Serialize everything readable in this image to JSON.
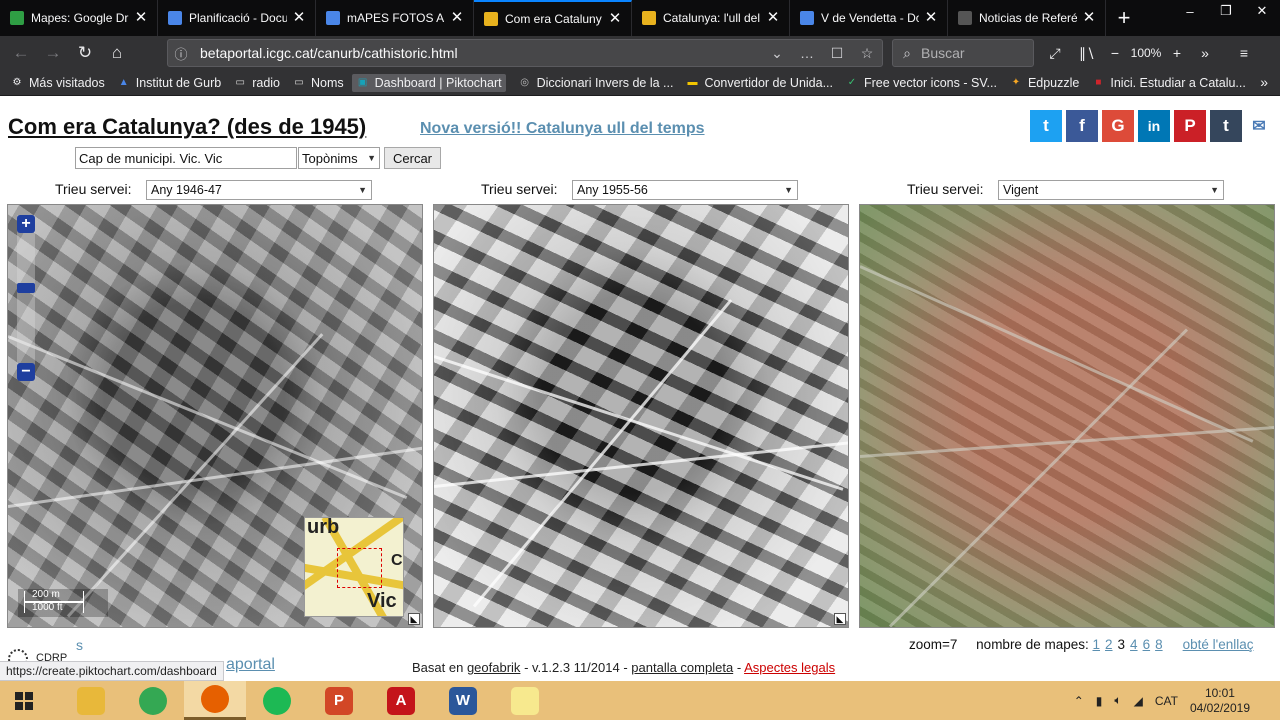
{
  "browser": {
    "tabs": [
      {
        "title": "Mapes: Google Dri",
        "icon_color": "#2f9e44",
        "active": false
      },
      {
        "title": "Planificació - Docu",
        "icon_color": "#4a86e8",
        "active": false
      },
      {
        "title": "mAPES FOTOS AN",
        "icon_color": "#4a86e8",
        "active": false
      },
      {
        "title": "Com era Cataluny",
        "icon_color": "#e8b21e",
        "active": true
      },
      {
        "title": "Catalunya: l'ull del",
        "icon_color": "#e8b21e",
        "active": false
      },
      {
        "title": "V de Vendetta - Do",
        "icon_color": "#4a86e8",
        "active": false
      },
      {
        "title": "Noticias de Referé",
        "icon_color": "#555555",
        "active": false
      }
    ],
    "url": "betaportal.icgc.cat/canurb/cathistoric.html",
    "search_placeholder": "Buscar",
    "zoom": "100%",
    "bookmarks": [
      {
        "label": "Más visitados",
        "icon": "gear-icon"
      },
      {
        "label": "Institut de Gurb",
        "icon": "school-icon"
      },
      {
        "label": "radio",
        "icon": "folder-icon"
      },
      {
        "label": "Noms",
        "icon": "folder-icon"
      },
      {
        "label": "Dashboard | Piktochart",
        "icon": "piktochart-icon"
      },
      {
        "label": "Diccionari Invers de la ...",
        "icon": "globe-icon"
      },
      {
        "label": "Convertidor de Unida...",
        "icon": "converter-icon"
      },
      {
        "label": "Free vector icons - SV...",
        "icon": "flaticon-icon"
      },
      {
        "label": "Edpuzzle",
        "icon": "edpuzzle-icon"
      },
      {
        "label": "Inici. Estudiar a Catalu...",
        "icon": "gencat-icon"
      }
    ]
  },
  "page": {
    "title": "Com era Catalunya? (des de 1945)",
    "new_version": "Nova versió!! Catalunya ull del temps",
    "search": {
      "value": "Cap de municipi. Vic. Vic",
      "type": "Topònims",
      "button": "Cercar"
    },
    "service_label": "Trieu servei:",
    "panels": [
      {
        "service": "Any 1946-47"
      },
      {
        "service": "Any 1955-56"
      },
      {
        "service": "Vigent"
      }
    ],
    "scale": {
      "metric": "200 m",
      "imperial": "1000 ft"
    },
    "overview": {
      "label1": "urb",
      "label2": "Vic",
      "label3": "C"
    },
    "zoom_text": "zoom=7",
    "maps_label": "nombre de mapes:",
    "map_counts": [
      "1",
      "2",
      "3",
      "4",
      "6",
      "8"
    ],
    "selected_count": "3",
    "get_link": "obté l'enllaç",
    "credits_prefix": "Basat en",
    "credits_link": "geofabrik",
    "credits_version": "- v.1.2.3 11/2014 -",
    "fullscreen": "pantalla completa",
    "legal": "Aspectes legals",
    "left_cut": "s",
    "cdrp": "CDRP",
    "aportal": "aportal"
  },
  "status_url": "https://create.piktochart.com/dashboard",
  "taskbar": {
    "apps": [
      {
        "name": "file-explorer",
        "color": "#e8b83a",
        "label": ""
      },
      {
        "name": "chrome",
        "color": "#34a853",
        "label": ""
      },
      {
        "name": "firefox",
        "color": "#e66000",
        "label": ""
      },
      {
        "name": "spotify",
        "color": "#1db954",
        "label": ""
      },
      {
        "name": "powerpoint",
        "color": "#d24726",
        "label": "P"
      },
      {
        "name": "acrobat",
        "color": "#c4141a",
        "label": "A"
      },
      {
        "name": "word",
        "color": "#2b579a",
        "label": "W"
      },
      {
        "name": "sticky-notes",
        "color": "#f7e98e",
        "label": ""
      }
    ],
    "language": "CAT",
    "time": "10:01",
    "date": "04/02/2019"
  }
}
